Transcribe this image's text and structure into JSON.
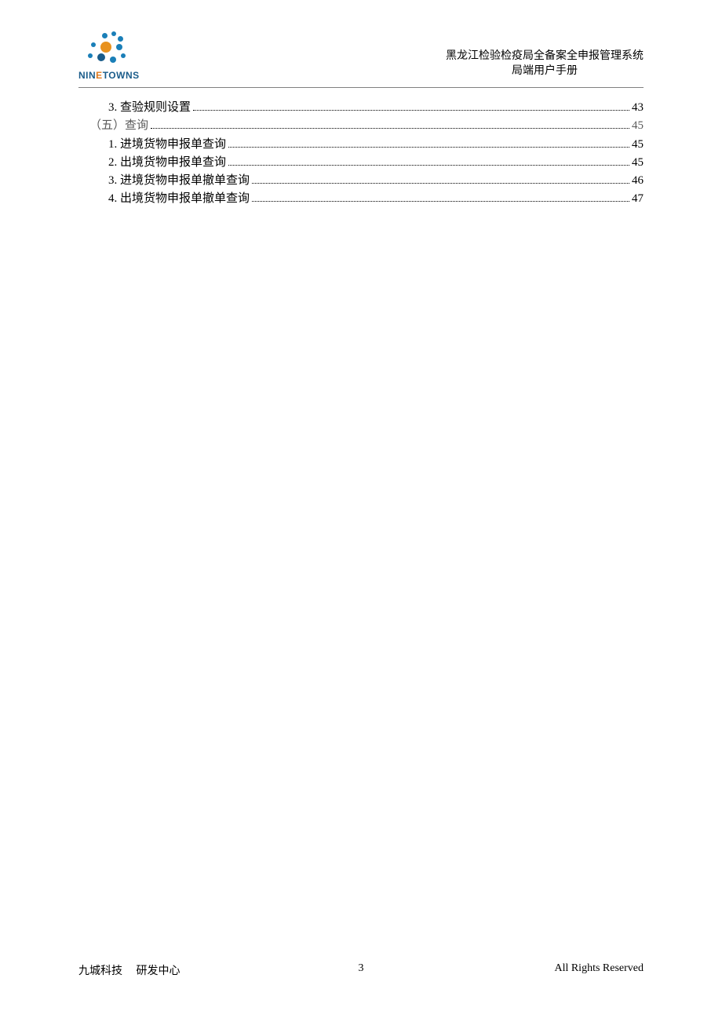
{
  "header": {
    "logo_text_prefix": "NIN",
    "logo_text_e": "E",
    "logo_text_suffix": "TOWNS",
    "title_line1": "黑龙江检验检疫局全备案全申报管理系统",
    "title_line2": "局端用户手册"
  },
  "toc": [
    {
      "indent": 1,
      "label": "3. 查验规则设置 ",
      "page": "43"
    },
    {
      "indent": 0,
      "label": "（五）查询",
      "page": "45"
    },
    {
      "indent": 1,
      "label": "1. 进境货物申报单查询 ",
      "page": "45"
    },
    {
      "indent": 1,
      "label": "2. 出境货物申报单查询 ",
      "page": "45"
    },
    {
      "indent": 1,
      "label": "3. 进境货物申报单撤单查询 ",
      "page": "46"
    },
    {
      "indent": 1,
      "label": "4. 出境货物申报单撤单查询 ",
      "page": "47"
    }
  ],
  "footer": {
    "left": "九城科技     研发中心",
    "center": "3",
    "right": "All Rights Reserved"
  }
}
